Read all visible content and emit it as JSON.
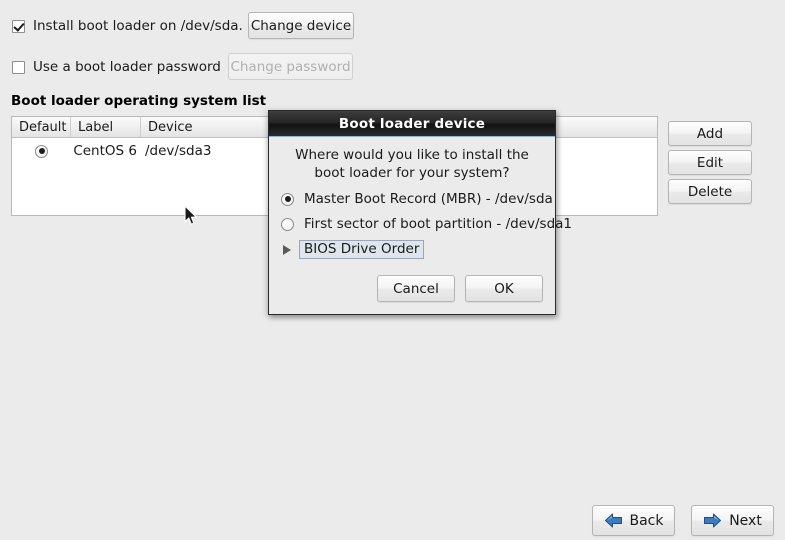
{
  "page": {
    "background_color": "#ebebeb"
  },
  "options": {
    "install_boot_loader": {
      "label": "Install boot loader on /dev/sda.",
      "checked": true
    },
    "use_password": {
      "label": "Use a boot loader password",
      "checked": false
    }
  },
  "buttons": {
    "change_device": "Change device",
    "change_password": "Change password",
    "change_password_disabled": true
  },
  "os_list": {
    "heading": "Boot loader operating system list",
    "columns": [
      "Default",
      "Label",
      "Device"
    ],
    "rows": [
      {
        "default": true,
        "label": "CentOS 6",
        "device": "/dev/sda3"
      }
    ]
  },
  "side_buttons": [
    {
      "label": "Add",
      "name": "add-button"
    },
    {
      "label": "Edit",
      "name": "edit-button"
    },
    {
      "label": "Delete",
      "name": "delete-button"
    }
  ],
  "nav_buttons": {
    "back": "Back",
    "next": "Next",
    "arrow_color": "#2f6fb5"
  },
  "dialog": {
    "title": "Boot loader device",
    "prompt_line1": "Where would you like to install the",
    "prompt_line2": "boot loader for your system?",
    "options": [
      {
        "label": "Master Boot Record (MBR) - /dev/sda",
        "selected": true
      },
      {
        "label": "First sector of boot partition - /dev/sda1",
        "selected": false
      }
    ],
    "expander": {
      "label": "BIOS Drive Order",
      "expanded": false,
      "focused": true
    },
    "cancel_label": "Cancel",
    "ok_label": "OK"
  }
}
